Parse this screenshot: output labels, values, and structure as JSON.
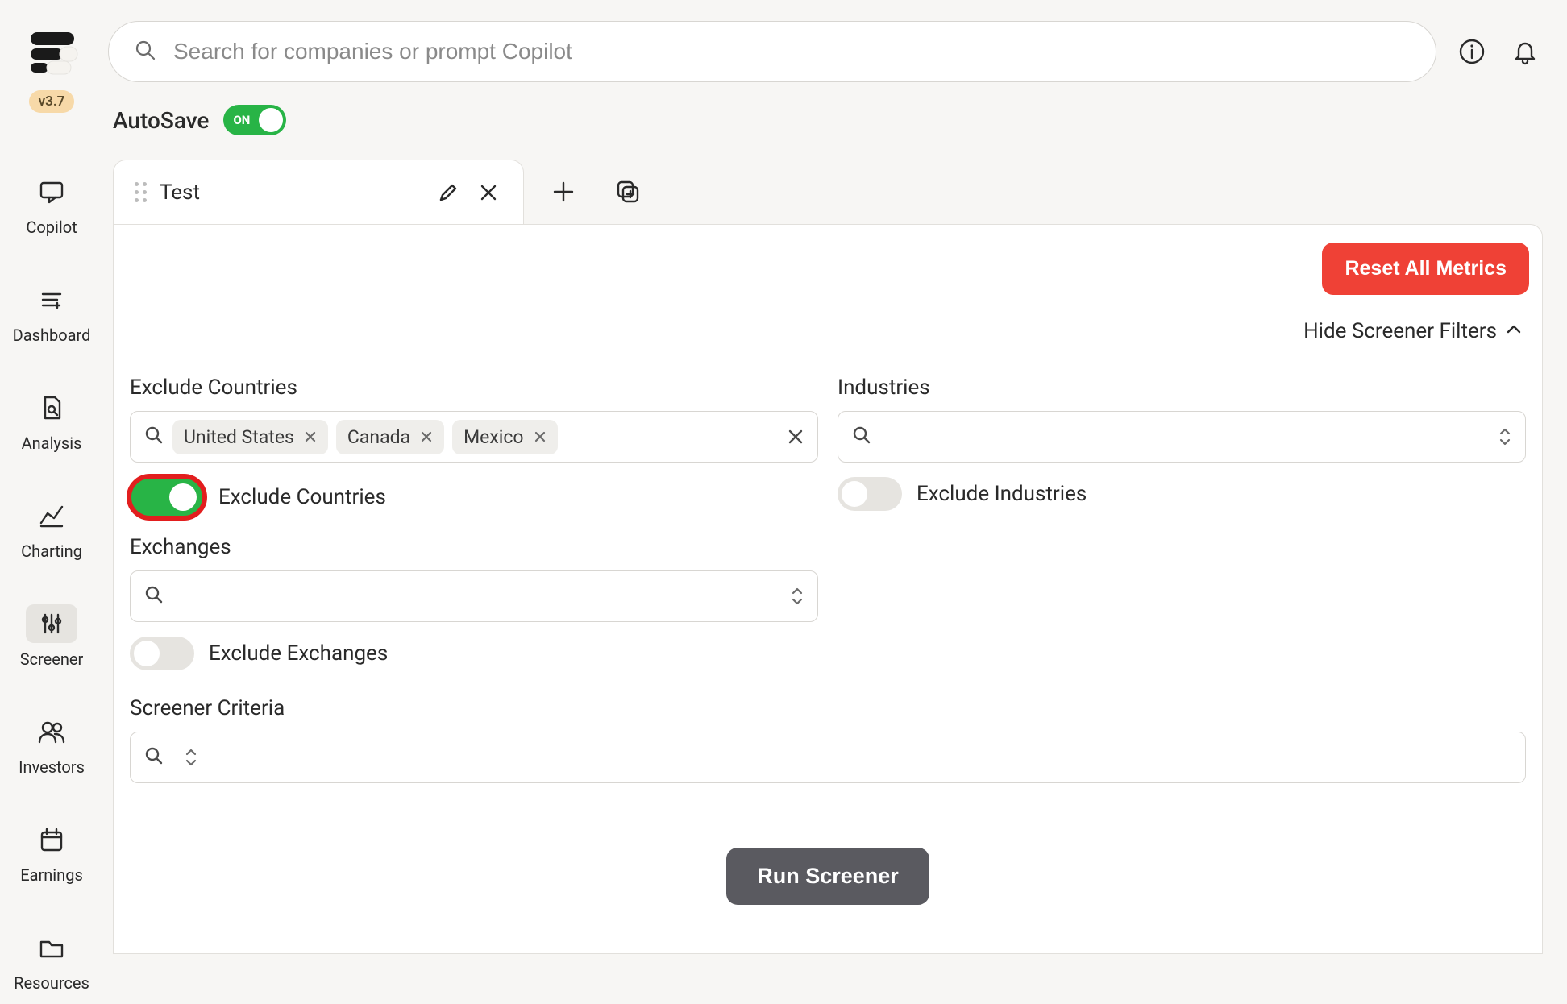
{
  "version": "v3.7",
  "search": {
    "placeholder": "Search for companies or prompt Copilot"
  },
  "sidebar": {
    "items": [
      {
        "label": "Copilot"
      },
      {
        "label": "Dashboard"
      },
      {
        "label": "Analysis"
      },
      {
        "label": "Charting"
      },
      {
        "label": "Screener"
      },
      {
        "label": "Investors"
      },
      {
        "label": "Earnings"
      },
      {
        "label": "Resources"
      }
    ]
  },
  "autosave": {
    "label": "AutoSave",
    "state": "ON"
  },
  "tabs": [
    {
      "title": "Test"
    }
  ],
  "panel": {
    "reset_label": "Reset All Metrics",
    "hide_filters_label": "Hide Screener Filters",
    "filters": {
      "countries": {
        "label": "Exclude Countries",
        "chips": [
          "United States",
          "Canada",
          "Mexico"
        ],
        "toggle_label": "Exclude Countries",
        "toggle_on": true
      },
      "industries": {
        "label": "Industries",
        "toggle_label": "Exclude Industries",
        "toggle_on": false
      },
      "exchanges": {
        "label": "Exchanges",
        "toggle_label": "Exclude Exchanges",
        "toggle_on": false
      },
      "criteria": {
        "label": "Screener Criteria"
      }
    },
    "run_label": "Run Screener"
  }
}
